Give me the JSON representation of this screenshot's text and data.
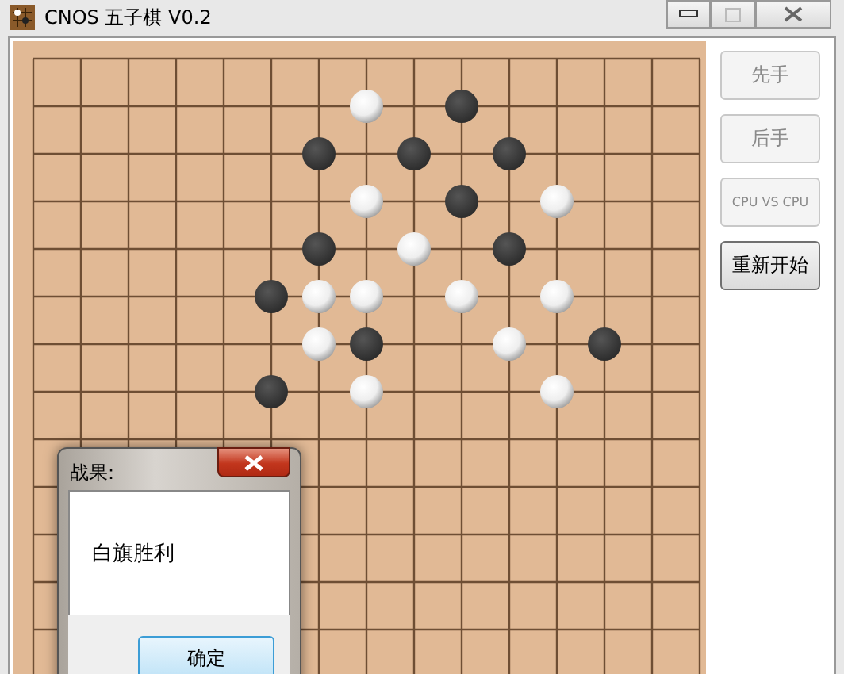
{
  "window": {
    "title": "CNOS 五子棋 V0.2",
    "maximize_disabled": true
  },
  "board": {
    "rows": [
      {
        "cells": [
          {
            "kind": "empty"
          },
          {
            "kind": "empty"
          },
          {
            "kind": "empty"
          },
          {
            "kind": "empty"
          },
          {
            "kind": "empty"
          },
          {
            "kind": "empty"
          },
          {
            "kind": "empty"
          },
          {
            "kind": "empty"
          },
          {
            "kind": "empty"
          },
          {
            "kind": "empty"
          },
          {
            "kind": "empty"
          },
          {
            "kind": "empty"
          },
          {
            "kind": "empty"
          },
          {
            "kind": "empty"
          },
          {
            "kind": "empty"
          }
        ]
      },
      {
        "cells": [
          {
            "kind": "empty"
          },
          {
            "kind": "empty"
          },
          {
            "kind": "empty"
          },
          {
            "kind": "empty"
          },
          {
            "kind": "empty"
          },
          {
            "kind": "empty"
          },
          {
            "kind": "empty"
          },
          {
            "kind": "white"
          },
          {
            "kind": "empty"
          },
          {
            "kind": "black"
          },
          {
            "kind": "empty"
          },
          {
            "kind": "empty"
          },
          {
            "kind": "empty"
          },
          {
            "kind": "empty"
          },
          {
            "kind": "empty"
          }
        ]
      },
      {
        "cells": [
          {
            "kind": "empty"
          },
          {
            "kind": "empty"
          },
          {
            "kind": "empty"
          },
          {
            "kind": "empty"
          },
          {
            "kind": "empty"
          },
          {
            "kind": "empty"
          },
          {
            "kind": "black"
          },
          {
            "kind": "empty"
          },
          {
            "kind": "black"
          },
          {
            "kind": "empty"
          },
          {
            "kind": "black"
          },
          {
            "kind": "empty"
          },
          {
            "kind": "empty"
          },
          {
            "kind": "empty"
          },
          {
            "kind": "empty"
          }
        ]
      },
      {
        "cells": [
          {
            "kind": "empty"
          },
          {
            "kind": "empty"
          },
          {
            "kind": "empty"
          },
          {
            "kind": "empty"
          },
          {
            "kind": "empty"
          },
          {
            "kind": "empty"
          },
          {
            "kind": "empty"
          },
          {
            "kind": "white"
          },
          {
            "kind": "empty"
          },
          {
            "kind": "black"
          },
          {
            "kind": "empty"
          },
          {
            "kind": "white"
          },
          {
            "kind": "empty"
          },
          {
            "kind": "empty"
          },
          {
            "kind": "empty"
          }
        ]
      },
      {
        "cells": [
          {
            "kind": "empty"
          },
          {
            "kind": "empty"
          },
          {
            "kind": "empty"
          },
          {
            "kind": "empty"
          },
          {
            "kind": "empty"
          },
          {
            "kind": "empty"
          },
          {
            "kind": "black"
          },
          {
            "kind": "empty"
          },
          {
            "kind": "white"
          },
          {
            "kind": "empty"
          },
          {
            "kind": "black"
          },
          {
            "kind": "empty"
          },
          {
            "kind": "empty"
          },
          {
            "kind": "empty"
          },
          {
            "kind": "empty"
          }
        ]
      },
      {
        "cells": [
          {
            "kind": "empty"
          },
          {
            "kind": "empty"
          },
          {
            "kind": "empty"
          },
          {
            "kind": "empty"
          },
          {
            "kind": "empty"
          },
          {
            "kind": "black"
          },
          {
            "kind": "white"
          },
          {
            "kind": "white"
          },
          {
            "kind": "empty"
          },
          {
            "kind": "white"
          },
          {
            "kind": "empty"
          },
          {
            "kind": "white"
          },
          {
            "kind": "empty"
          },
          {
            "kind": "empty"
          },
          {
            "kind": "empty"
          }
        ]
      },
      {
        "cells": [
          {
            "kind": "empty"
          },
          {
            "kind": "empty"
          },
          {
            "kind": "empty"
          },
          {
            "kind": "empty"
          },
          {
            "kind": "empty"
          },
          {
            "kind": "empty"
          },
          {
            "kind": "white"
          },
          {
            "kind": "black"
          },
          {
            "kind": "empty"
          },
          {
            "kind": "empty"
          },
          {
            "kind": "white"
          },
          {
            "kind": "empty"
          },
          {
            "kind": "black"
          },
          {
            "kind": "empty"
          },
          {
            "kind": "empty"
          }
        ]
      },
      {
        "cells": [
          {
            "kind": "empty"
          },
          {
            "kind": "empty"
          },
          {
            "kind": "empty"
          },
          {
            "kind": "empty"
          },
          {
            "kind": "empty"
          },
          {
            "kind": "black"
          },
          {
            "kind": "empty"
          },
          {
            "kind": "white"
          },
          {
            "kind": "empty"
          },
          {
            "kind": "empty"
          },
          {
            "kind": "empty"
          },
          {
            "kind": "white"
          },
          {
            "kind": "empty"
          },
          {
            "kind": "empty"
          },
          {
            "kind": "empty"
          }
        ]
      }
    ]
  },
  "buttons": [
    {
      "label": "先手",
      "disabled": true
    },
    {
      "label": "后手",
      "disabled": true
    },
    {
      "label": "CPU VS CPU",
      "disabled": true
    },
    {
      "label": "重新开始",
      "disabled": false
    }
  ],
  "dialog": {
    "title": "战果:",
    "message": "白旗胜利",
    "ok_button": "确定"
  }
}
